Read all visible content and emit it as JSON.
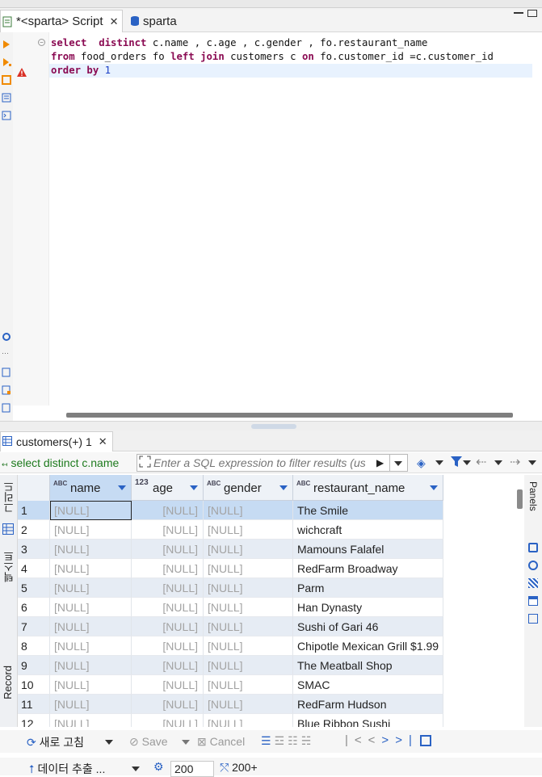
{
  "tabs": [
    {
      "label": "*<sparta> Script",
      "active": true
    },
    {
      "label": "sparta",
      "active": false
    }
  ],
  "editor": {
    "lines": [
      {
        "parts": [
          [
            "kw",
            "select"
          ],
          [
            "t",
            "  "
          ],
          [
            "kw",
            "distinct"
          ],
          [
            "t",
            " c.name , c.age , c.gender , fo.restaurant_name"
          ]
        ]
      },
      {
        "parts": [
          [
            "kw",
            "from"
          ],
          [
            "t",
            " food_orders fo "
          ],
          [
            "kw",
            "left join"
          ],
          [
            "t",
            " customers c "
          ],
          [
            "kw",
            "on"
          ],
          [
            "t",
            " fo.customer_id =c.customer_id"
          ]
        ]
      },
      {
        "parts": [
          [
            "kw",
            "order by"
          ],
          [
            "t",
            " "
          ],
          [
            "num",
            "1"
          ]
        ]
      }
    ]
  },
  "results": {
    "tab_label": "customers(+) 1",
    "query_text": "select distinct c.name",
    "filter_placeholder": "Enter a SQL expression to filter results (use Ctrl+Space)",
    "columns": [
      {
        "type": "ABC",
        "label": "name"
      },
      {
        "type": "123",
        "label": "age"
      },
      {
        "type": "ABC",
        "label": "gender"
      },
      {
        "type": "ABC",
        "label": "restaurant_name"
      }
    ],
    "rows": [
      [
        "1",
        "[NULL]",
        "[NULL]",
        "[NULL]",
        "The Smile"
      ],
      [
        "2",
        "[NULL]",
        "[NULL]",
        "[NULL]",
        "wichcraft"
      ],
      [
        "3",
        "[NULL]",
        "[NULL]",
        "[NULL]",
        "Mamouns Falafel"
      ],
      [
        "4",
        "[NULL]",
        "[NULL]",
        "[NULL]",
        "RedFarm Broadway"
      ],
      [
        "5",
        "[NULL]",
        "[NULL]",
        "[NULL]",
        "Parm"
      ],
      [
        "6",
        "[NULL]",
        "[NULL]",
        "[NULL]",
        "Han Dynasty"
      ],
      [
        "7",
        "[NULL]",
        "[NULL]",
        "[NULL]",
        "Sushi of Gari 46"
      ],
      [
        "8",
        "[NULL]",
        "[NULL]",
        "[NULL]",
        "Chipotle Mexican Grill $1.99"
      ],
      [
        "9",
        "[NULL]",
        "[NULL]",
        "[NULL]",
        "The Meatball Shop"
      ],
      [
        "10",
        "[NULL]",
        "[NULL]",
        "[NULL]",
        "SMAC"
      ],
      [
        "11",
        "[NULL]",
        "[NULL]",
        "[NULL]",
        "RedFarm Hudson"
      ],
      [
        "12",
        "[NULL]",
        "[NULL]",
        "[NULL]",
        "Blue Ribbon Sushi"
      ]
    ],
    "side_tabs": {
      "grid": "그리드",
      "text": "텍스트",
      "record": "Record",
      "panels": "Panels"
    }
  },
  "toolbar": {
    "refresh_label": "새로 고침",
    "save_label": "Save",
    "cancel_label": "Cancel",
    "export_label": "데이터 추출 ...",
    "fetch_size": "200",
    "row_count": "200+"
  }
}
